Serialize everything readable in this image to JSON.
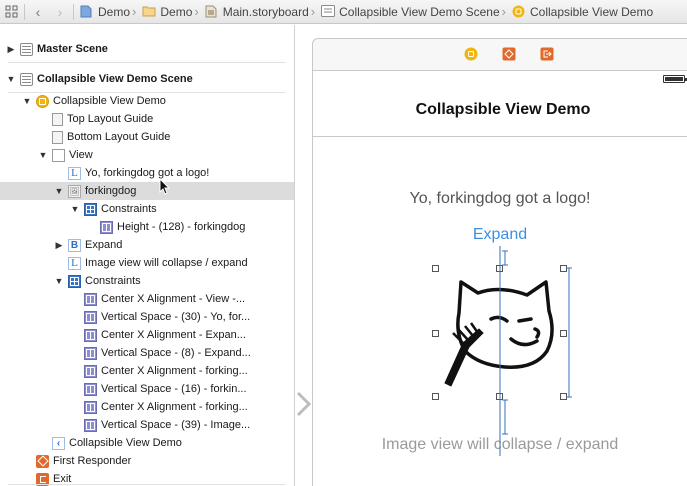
{
  "jumpbar": {
    "crumbs": [
      {
        "label": "Demo",
        "icon": "project-icon"
      },
      {
        "label": "Demo",
        "icon": "folder-icon"
      },
      {
        "label": "Main.storyboard",
        "icon": "storyboard-icon"
      },
      {
        "label": "Collapsible View Demo Scene",
        "icon": "scene-icon"
      },
      {
        "label": "Collapsible View Demo",
        "icon": "view-controller-icon"
      }
    ]
  },
  "outline": {
    "rows": [
      {
        "label": "Master Scene",
        "icon": "scene",
        "indent": 0,
        "triangle": "right",
        "scene": true
      },
      {
        "label": "Collapsible View Demo Scene",
        "icon": "scene",
        "indent": 0,
        "triangle": "down",
        "scene": true
      },
      {
        "label": "Collapsible View Demo",
        "icon": "vc",
        "indent": 1,
        "triangle": "down"
      },
      {
        "label": "Top Layout Guide",
        "icon": "guide",
        "indent": 2,
        "triangle": ""
      },
      {
        "label": "Bottom Layout Guide",
        "icon": "guide",
        "indent": 2,
        "triangle": ""
      },
      {
        "label": "View",
        "icon": "view",
        "indent": 2,
        "triangle": "down"
      },
      {
        "label": "Yo, forkingdog got a logo!",
        "icon": "label",
        "indent": 3,
        "triangle": ""
      },
      {
        "label": "forkingdog",
        "icon": "image",
        "indent": 3,
        "triangle": "down",
        "selected": true
      },
      {
        "label": "Constraints",
        "icon": "cons",
        "indent": 4,
        "triangle": "down"
      },
      {
        "label": "Height - (128) - forkingdog",
        "icon": "c",
        "indent": 5,
        "triangle": ""
      },
      {
        "label": "Expand",
        "icon": "button",
        "indent": 3,
        "triangle": "right"
      },
      {
        "label": "Image view will collapse / expand",
        "icon": "label",
        "indent": 3,
        "triangle": ""
      },
      {
        "label": "Constraints",
        "icon": "cons",
        "indent": 3,
        "triangle": "down"
      },
      {
        "label": "Center X Alignment - View -...",
        "icon": "c",
        "indent": 4,
        "triangle": ""
      },
      {
        "label": "Vertical Space - (30) - Yo, for...",
        "icon": "c",
        "indent": 4,
        "triangle": ""
      },
      {
        "label": "Center X Alignment - Expan...",
        "icon": "c",
        "indent": 4,
        "triangle": ""
      },
      {
        "label": "Vertical Space - (8) - Expand...",
        "icon": "c",
        "indent": 4,
        "triangle": ""
      },
      {
        "label": "Center X Alignment - forking...",
        "icon": "c",
        "indent": 4,
        "triangle": ""
      },
      {
        "label": "Vertical Space - (16) - forkin...",
        "icon": "c",
        "indent": 4,
        "triangle": ""
      },
      {
        "label": "Center X Alignment - forking...",
        "icon": "c",
        "indent": 4,
        "triangle": ""
      },
      {
        "label": "Vertical Space - (39) - Image...",
        "icon": "c",
        "indent": 4,
        "triangle": ""
      },
      {
        "label": "Collapsible View Demo",
        "icon": "seg",
        "indent": 2,
        "triangle": ""
      },
      {
        "label": "First Responder",
        "icon": "fr",
        "indent": 1,
        "triangle": ""
      },
      {
        "label": "Exit",
        "icon": "exit",
        "indent": 1,
        "triangle": ""
      }
    ]
  },
  "canvas": {
    "nav_title": "Collapsible View Demo",
    "logo_label": "Yo, forkingdog got a logo!",
    "expand_button": "Expand",
    "collapse_label": "Image view will collapse / expand"
  },
  "colors": {
    "accent": "#3d8fe0",
    "selection": "#dcdcdc",
    "constraint": "#3a75c4"
  }
}
